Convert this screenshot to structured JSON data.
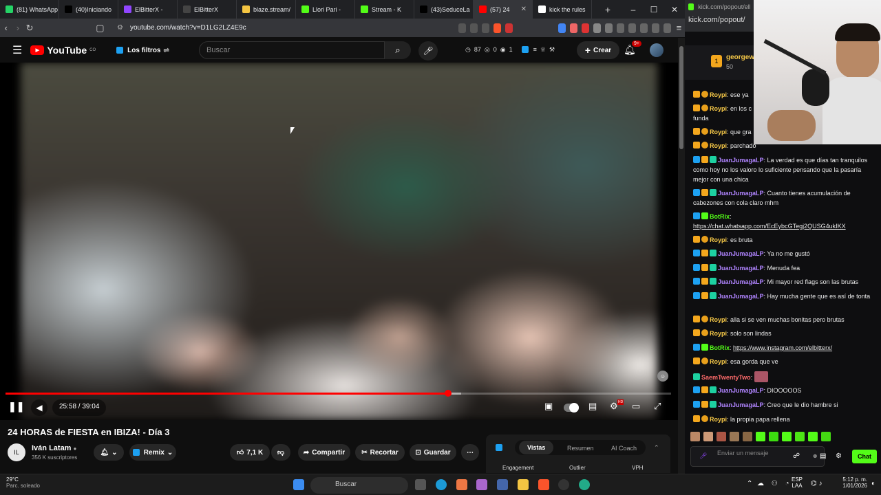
{
  "tabs": [
    {
      "label": "(81) WhatsApp",
      "color": "#25d366"
    },
    {
      "label": "(40)Iniciando",
      "color": "#000000"
    },
    {
      "label": "ElBitterX -",
      "color": "#9146ff"
    },
    {
      "label": "ElBitterX",
      "color": "#444444"
    },
    {
      "label": "blaze.stream/",
      "color": "#f4c542"
    },
    {
      "label": "Llori Pari -",
      "color": "#53fc18"
    },
    {
      "label": "Stream - K",
      "color": "#53fc18"
    },
    {
      "label": "(43)SeduceLa",
      "color": "#000000"
    },
    {
      "label": "(57) 24",
      "color": "#ff0000",
      "active": true
    },
    {
      "label": "kick the rules",
      "color": "#ffffff"
    }
  ],
  "address": {
    "url": "youtube.com/watch?v=D1LG2LZ4E9c"
  },
  "kick": {
    "url": "kick.com/popout/elbitte",
    "url2": "kick.com/popout/"
  },
  "yt": {
    "logo": "YouTube",
    "country": "CO",
    "filters": "Los filtros",
    "search_placeholder": "Buscar",
    "stats": {
      "a": "87",
      "b": "0",
      "c": "1"
    },
    "crear": "Crear",
    "notif": "9+"
  },
  "player": {
    "time": "25:58 / 39:04",
    "progress": 0.665,
    "buffered": 0.685
  },
  "video": {
    "title": "24 HORAS de FIESTA en IBIZA! - Día 3",
    "channel": "Iván Latam",
    "subs": "356 K suscriptores",
    "remix": "Remix",
    "likes": "7,1 K",
    "share": "Compartir",
    "clip": "Recortar",
    "save": "Guardar"
  },
  "panel": {
    "tabs": [
      "Vistas",
      "Resumen",
      "AI Coach"
    ],
    "cols": [
      "Engagement",
      "Outlier",
      "VPH"
    ]
  },
  "pinned": {
    "user": "georgew",
    "points": "50"
  },
  "chat": [
    {
      "user": "Roypi",
      "cls": "u-y",
      "badges": "kc",
      "text": "ese ya"
    },
    {
      "user": "Roypi",
      "cls": "u-y",
      "badges": "kc",
      "text": "en los c",
      "text2": "funda"
    },
    {
      "user": "Roypi",
      "cls": "u-y",
      "badges": "kc",
      "text": "que gra"
    },
    {
      "user": "Roypi",
      "cls": "u-y",
      "badges": "kc",
      "text": "parchado"
    },
    {
      "user": "JuanJumagaLP",
      "cls": "u-p",
      "badges": "bkt",
      "text": "La verdad es que días tan tranquilos como hoy no los valoro lo suficiente pensando que la pasaría mejor con una chica"
    },
    {
      "user": "JuanJumagaLP",
      "cls": "u-p",
      "badges": "bkt",
      "text": "Cuanto tienes acumulación de cabezones con cola claro mhm"
    },
    {
      "user": "BotRix",
      "cls": "u-g",
      "badges": "bg",
      "text": "https://chat.whatsapp.com/EcEybcGTegj2QUSG4ukIKX",
      "link": true
    },
    {
      "user": "Roypi",
      "cls": "u-y",
      "badges": "kc",
      "text": "es bruta"
    },
    {
      "user": "JuanJumagaLP",
      "cls": "u-p",
      "badges": "bkt",
      "text": "Ya no me gustó"
    },
    {
      "user": "JuanJumagaLP",
      "cls": "u-p",
      "badges": "bkt",
      "text": "Menuda fea"
    },
    {
      "user": "JuanJumagaLP",
      "cls": "u-p",
      "badges": "bkt",
      "text": "Mi mayor red flags son las brutas"
    },
    {
      "user": "JuanJumagaLP",
      "cls": "u-p",
      "badges": "bkt",
      "text": "Hay mucha gente que es así de tonta"
    },
    {
      "user": "Roypi",
      "cls": "u-y",
      "badges": "kc",
      "text": "alla si se ven muchas bonitas pero brutas"
    },
    {
      "user": "Roypi",
      "cls": "u-y",
      "badges": "kc",
      "text": "solo son lindas"
    },
    {
      "user": "BotRix",
      "cls": "u-g",
      "badges": "bg",
      "text": "https://www.instagram.com/elbitterx/",
      "link": true
    },
    {
      "user": "Roypi",
      "cls": "u-y",
      "badges": "kc",
      "text": "esa gorda que ve"
    },
    {
      "user": "SaemTwentyTwo",
      "cls": "u-r",
      "badges": "t",
      "text": ""
    },
    {
      "user": "JuanJumagaLP",
      "cls": "u-p",
      "badges": "bkt",
      "text": "DIOOOOOS"
    },
    {
      "user": "JuanJumagaLP",
      "cls": "u-p",
      "badges": "bkt",
      "text": "Creo que le dio hambre si"
    },
    {
      "user": "Roypi",
      "cls": "u-y",
      "badges": "kc",
      "text": "la propia papa rellena"
    }
  ],
  "chat_input": {
    "placeholder": "Enviar un mensaje",
    "send": "Chat"
  },
  "taskbar": {
    "temp": "29°C",
    "weather": "Parc. soleado",
    "search": "Buscar",
    "lang": "ESP",
    "lang2": "LAA",
    "time": "5:12 p. m.",
    "date": "1/01/2026"
  }
}
